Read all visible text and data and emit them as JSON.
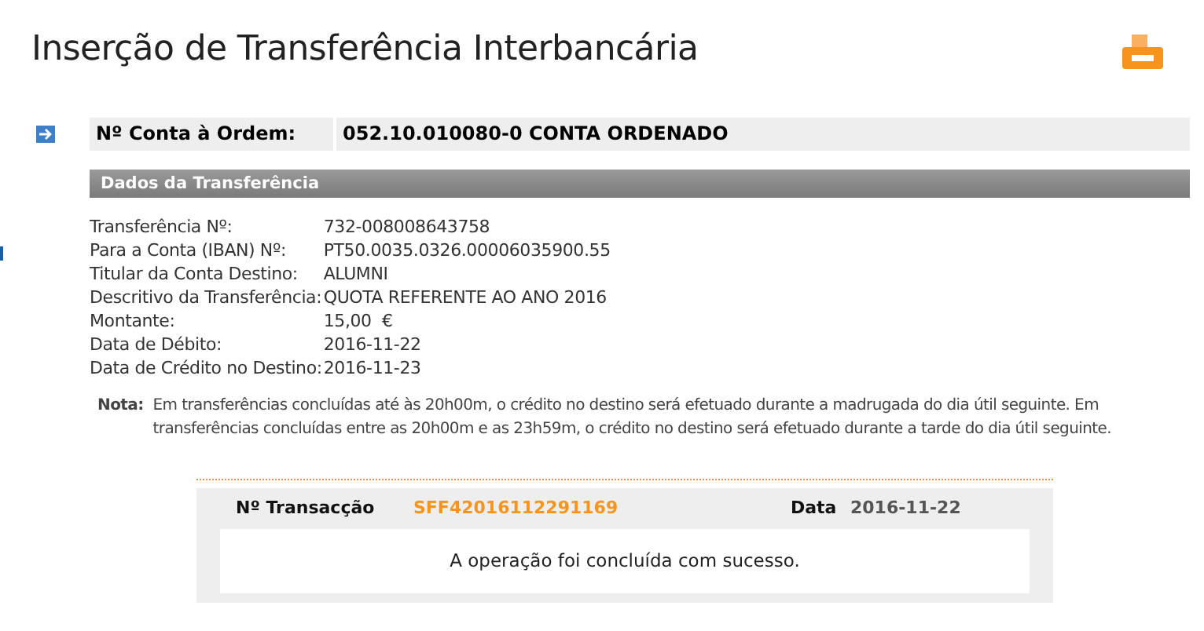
{
  "page": {
    "title": "Inserção de Transferência Interbancária"
  },
  "account": {
    "label": "Nº Conta à Ordem:",
    "value": "052.10.010080-0 CONTA ORDENADO"
  },
  "section": {
    "title": "Dados da Transferência"
  },
  "details": [
    {
      "label": "Transferência Nº:",
      "value": "732-008008643758"
    },
    {
      "label": "Para a Conta (IBAN) Nº:",
      "value": "PT50.0035.0326.00006035900.55"
    },
    {
      "label": "Titular da Conta Destino:",
      "value": "ALUMNI"
    },
    {
      "label": "Descritivo da Transferência:",
      "value": "QUOTA REFERENTE AO ANO 2016"
    },
    {
      "label": "Montante:",
      "value": "15,00  €"
    },
    {
      "label": "Data de Débito:",
      "value": "2016-11-22"
    },
    {
      "label": "Data de Crédito no Destino:",
      "value": "2016-11-23"
    }
  ],
  "note": {
    "label": "Nota:",
    "text": "Em transferências concluídas até às 20h00m, o crédito no destino será efetuado durante a madrugada do dia útil seguinte. Em transferências concluídas entre as 20h00m e as 23h59m, o crédito no destino será efetuado durante a tarde do dia útil seguinte."
  },
  "result": {
    "transaction_label": "Nº Transacção",
    "transaction_value": "SFF42016112291169",
    "date_label": "Data",
    "date_value": "2016-11-22",
    "message": "A operação foi concluída com sucesso."
  }
}
